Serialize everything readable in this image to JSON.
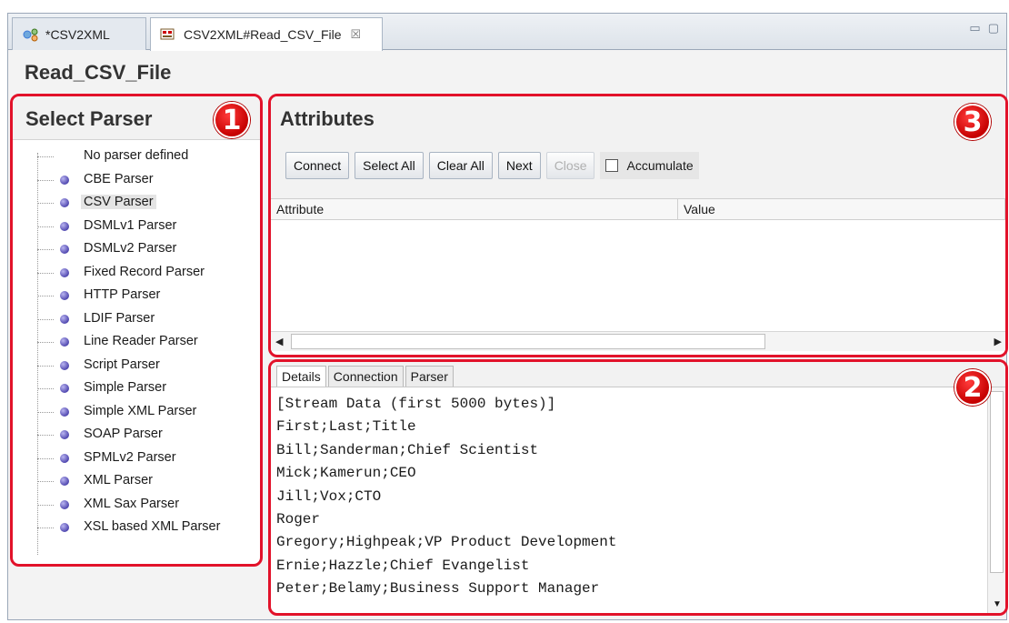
{
  "tabs": [
    {
      "label": "*CSV2XML",
      "icon": "project-icon",
      "active": false
    },
    {
      "label": "CSV2XML#Read_CSV_File",
      "icon": "connector-icon",
      "active": true,
      "close": "☒"
    }
  ],
  "window_controls": {
    "minimize": "▭",
    "maximize": "▢"
  },
  "editor_title": "Read_CSV_File",
  "parser_panel": {
    "title": "Select Parser",
    "badge": "1",
    "items": [
      {
        "label": "No parser defined",
        "dot": false
      },
      {
        "label": "CBE Parser",
        "dot": true
      },
      {
        "label": "CSV Parser",
        "dot": true,
        "selected": true
      },
      {
        "label": "DSMLv1 Parser",
        "dot": true
      },
      {
        "label": "DSMLv2 Parser",
        "dot": true
      },
      {
        "label": "Fixed Record Parser",
        "dot": true
      },
      {
        "label": "HTTP Parser",
        "dot": true
      },
      {
        "label": "LDIF Parser",
        "dot": true
      },
      {
        "label": "Line Reader Parser",
        "dot": true
      },
      {
        "label": "Script Parser",
        "dot": true
      },
      {
        "label": "Simple Parser",
        "dot": true
      },
      {
        "label": "Simple XML Parser",
        "dot": true
      },
      {
        "label": "SOAP Parser",
        "dot": true
      },
      {
        "label": "SPMLv2 Parser",
        "dot": true
      },
      {
        "label": "XML Parser",
        "dot": true
      },
      {
        "label": "XML Sax Parser",
        "dot": true
      },
      {
        "label": "XSL based XML Parser",
        "dot": true
      }
    ]
  },
  "attributes_panel": {
    "title": "Attributes",
    "badge": "3",
    "buttons": {
      "connect": "Connect",
      "select_all": "Select All",
      "clear_all": "Clear All",
      "next": "Next",
      "close": "Close"
    },
    "accumulate_label": "Accumulate",
    "accumulate_checked": false,
    "columns": [
      "Attribute",
      "Value"
    ]
  },
  "details_panel": {
    "badge": "2",
    "tabs": [
      "Details",
      "Connection",
      "Parser"
    ],
    "active_tab": "Details",
    "lines": [
      "[Stream Data (first 5000 bytes)]",
      "First;Last;Title",
      "Bill;Sanderman;Chief Scientist",
      "Mick;Kamerun;CEO",
      "Jill;Vox;CTO",
      "Roger",
      "Gregory;Highpeak;VP Product Development",
      "Ernie;Hazzle;Chief Evangelist",
      "Peter;Belamy;Business Support Manager"
    ]
  },
  "colors": {
    "callout": "#e2122a",
    "parser_dot": "#5048b0"
  }
}
